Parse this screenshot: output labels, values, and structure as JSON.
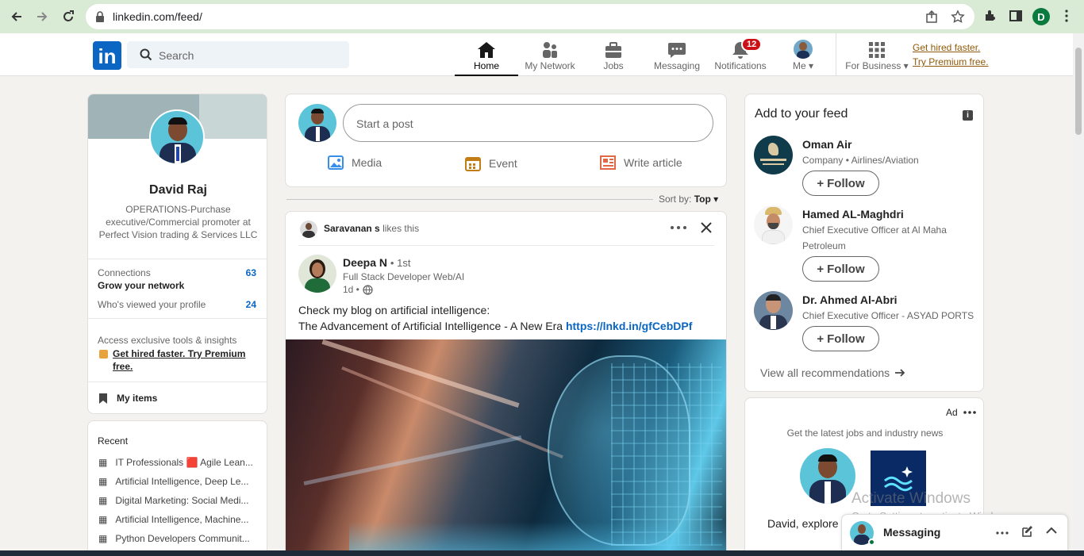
{
  "browser": {
    "url": "linkedin.com/feed/",
    "profile_initial": "D"
  },
  "header": {
    "logo": "in",
    "search_placeholder": "Search",
    "nav": [
      {
        "label": "Home",
        "icon": "home-icon",
        "active": true
      },
      {
        "label": "My Network",
        "icon": "network-icon",
        "active": false
      },
      {
        "label": "Jobs",
        "icon": "jobs-icon",
        "active": false
      },
      {
        "label": "Messaging",
        "icon": "messaging-icon",
        "active": false
      },
      {
        "label": "Notifications",
        "icon": "bell-icon",
        "active": false
      }
    ],
    "notifications_count": "12",
    "me_label": "Me",
    "business_label": "For Business",
    "premium_line1": "Get hired faster.",
    "premium_line2": "Try Premium free."
  },
  "profile": {
    "name": "David Raj",
    "headline": "OPERATIONS-Purchase executive/Commercial promoter at Perfect Vision trading & Services LLC",
    "connections_label": "Connections",
    "connections_count": "63",
    "grow_label": "Grow your network",
    "viewed_label": "Who's viewed your profile",
    "viewed_count": "24",
    "access_label": "Access exclusive tools & insights",
    "premium_text": "Get hired faster. Try Premium free.",
    "my_items": "My items"
  },
  "recent": {
    "title": "Recent",
    "items": [
      "IT Professionals 🟥 Agile Lean...",
      "Artificial Intelligence, Deep Le...",
      "Digital Marketing: Social Medi...",
      "Artificial Intelligence, Machine...",
      "Python Developers Communit..."
    ]
  },
  "share": {
    "placeholder": "Start a post",
    "media": "Media",
    "event": "Event",
    "article": "Write article",
    "sort_label": "Sort by:",
    "sort_value": "Top"
  },
  "post": {
    "liker": "Saravanan s",
    "likes_text": "likes this",
    "author": "Deepa N",
    "degree": "• 1st",
    "author_headline": "Full Stack Developer Web/AI",
    "time": "1d •",
    "text_line1": "Check my blog on artificial intelligence:",
    "text_line2": "The Advancement of Artificial Intelligence - A New Era",
    "link": "https://lnkd.in/gfCebDPf"
  },
  "feed_suggestions": {
    "title": "Add to your feed",
    "follow_label": "Follow",
    "items": [
      {
        "name": "Oman Air",
        "sub": "Company • Airlines/Aviation"
      },
      {
        "name": "Hamed AL-Maghdri",
        "sub": "Chief Executive Officer at Al Maha Petroleum"
      },
      {
        "name": "Dr. Ahmed Al-Abri",
        "sub": "Chief Executive Officer - ASYAD PORTS"
      }
    ],
    "view_all": "View all recommendations"
  },
  "ad": {
    "label": "Ad",
    "tagline": "Get the latest jobs and industry news",
    "body": "David, explore"
  },
  "messaging": {
    "label": "Messaging"
  },
  "watermark": {
    "line1": "Activate Windows",
    "line2": "Go to Settings to activate Windows."
  },
  "colors": {
    "linkedin_blue": "#0a66c2",
    "notification_red": "#cc1016",
    "premium_gold": "#915907"
  }
}
